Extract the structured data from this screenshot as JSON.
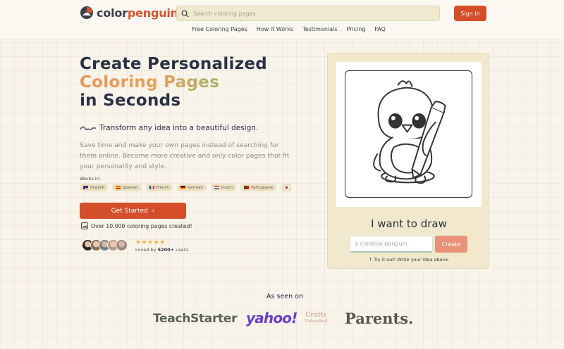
{
  "header": {
    "logo_part1": "color",
    "logo_part2": "penguin",
    "search_placeholder": "Search coloring pages",
    "signin_label": "Sign In",
    "nav": [
      "Free Coloring Pages",
      "How it Works",
      "Testimonials",
      "Pricing",
      "FAQ"
    ]
  },
  "hero": {
    "title_line1": "Create Personalized",
    "title_line2": "Coloring Pages",
    "title_line3": "in Seconds",
    "tagline": "Transform any idea into a beautiful design.",
    "description": "Save time and make your own pages instead of searching for them online. Become more creative and only color pages that fit your personality and style.",
    "works_in_label": "Works in:",
    "languages": [
      {
        "name": "English",
        "flag": "us-flag"
      },
      {
        "name": "Spanish",
        "flag": "es-flag"
      },
      {
        "name": "French",
        "flag": "fr-flag"
      },
      {
        "name": "German",
        "flag": "de-flag"
      },
      {
        "name": "Dutch",
        "flag": "nl-flag"
      },
      {
        "name": "Portuguese",
        "flag": "pt-flag"
      },
      {
        "name": "",
        "flag": "jp-flag"
      }
    ],
    "cta_label": "Get Started",
    "pages_created": "Over 10.000 coloring pages created!",
    "stars": "★★★★★",
    "loved_prefix": "Loved by ",
    "loved_count": "5200+",
    "loved_suffix": " users."
  },
  "generator": {
    "heading": "I want to draw",
    "input_placeholder": "a creative penguin.",
    "create_label": "Create",
    "hint": "Try it out! Write your idea above."
  },
  "press": {
    "label": "As seen on",
    "logos": [
      "TeachStarter",
      "yahoo!",
      "Crafts",
      "Parents."
    ],
    "crafts_sub": "Unleashed"
  },
  "colors": {
    "brand_orange": "#d44e29",
    "background": "#f8f4ea",
    "card": "#f2e8cd"
  }
}
